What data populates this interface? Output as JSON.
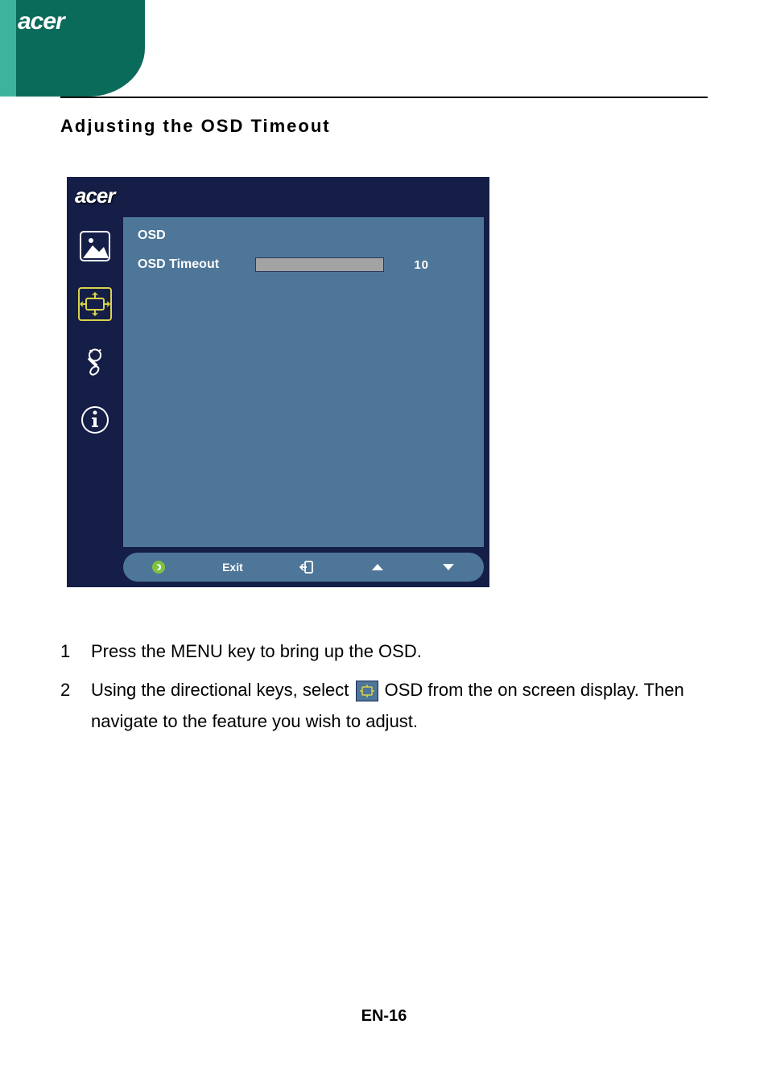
{
  "header": {
    "logo": "acer"
  },
  "title": "Adjusting the OSD Timeout",
  "osd": {
    "logo": "acer",
    "section": "OSD",
    "item_label": "OSD Timeout",
    "item_value": "10",
    "footer": {
      "exit": "Exit"
    }
  },
  "instructions": {
    "step1_num": "1",
    "step1": "Press the MENU key to bring up the OSD.",
    "step2_num": "2",
    "step2_a": "Using the directional keys, select ",
    "step2_b": " OSD from the on screen display. Then navigate to the feature you wish to adjust."
  },
  "page_number": "EN-16"
}
